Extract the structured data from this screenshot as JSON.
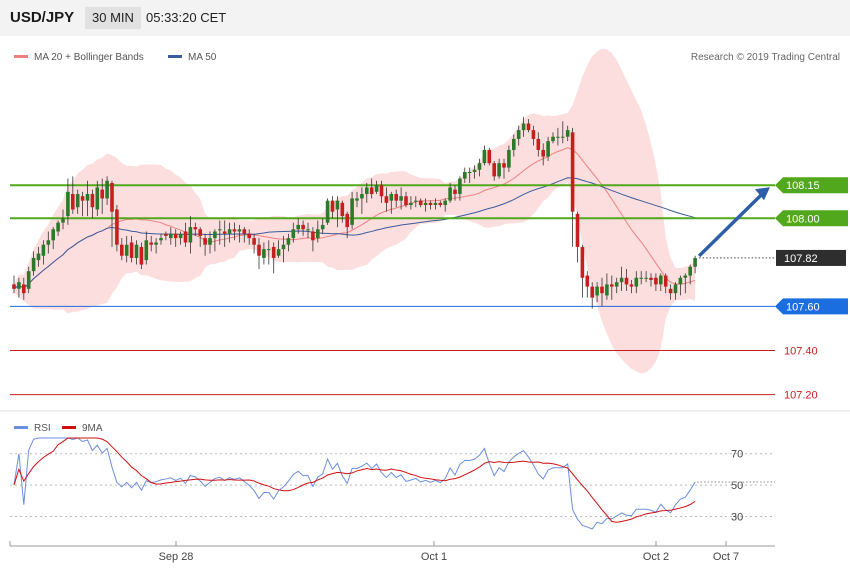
{
  "header": {
    "symbol": "USD/JPY",
    "timeframe": "30 MIN",
    "time": "05:33:20 CET"
  },
  "legend": {
    "ma20": {
      "label": "MA 20 + Bollinger Bands",
      "color": "#f08080"
    },
    "ma50": {
      "label": "MA 50",
      "color": "#3a5c9c"
    }
  },
  "credit": "Research © 2019 Trading Central",
  "rsi_legend": {
    "rsi": {
      "label": "RSI",
      "color": "#6a8ee0"
    },
    "ma9": {
      "label": "9MA",
      "color": "#d01010"
    }
  },
  "chart_data": {
    "type": "candlestick",
    "x_labels": [
      "Sep 28",
      "Oct 1",
      "Oct 2",
      "Oct 7"
    ],
    "price_ylim": [
      107.13,
      108.7
    ],
    "levels": [
      {
        "value": 108.15,
        "label": "108.15",
        "kind": "resistance",
        "color": "#52a81c"
      },
      {
        "value": 108.0,
        "label": "108.00",
        "kind": "resistance",
        "color": "#52a81c"
      },
      {
        "value": 107.82,
        "label": "107.82",
        "kind": "current",
        "color": "#222222"
      },
      {
        "value": 107.6,
        "label": "107.60",
        "kind": "support",
        "color": "#1a6ee0"
      },
      {
        "value": 107.4,
        "label": "107.40",
        "kind": "support",
        "color": "#c81e1e"
      },
      {
        "value": 107.2,
        "label": "107.20",
        "kind": "support",
        "color": "#c81e1e"
      }
    ],
    "candles": [
      [
        107.7,
        107.68,
        107.74,
        107.66
      ],
      [
        107.68,
        107.71,
        107.73,
        107.64
      ],
      [
        107.7,
        107.66,
        107.73,
        107.63
      ],
      [
        107.68,
        107.76,
        107.78,
        107.66
      ],
      [
        107.76,
        107.82,
        107.85,
        107.74
      ],
      [
        107.81,
        107.84,
        107.87,
        107.78
      ],
      [
        107.83,
        107.88,
        107.9,
        107.79
      ],
      [
        107.88,
        107.9,
        107.94,
        107.84
      ],
      [
        107.9,
        107.95,
        107.96,
        107.86
      ],
      [
        107.94,
        107.98,
        107.99,
        107.92
      ],
      [
        107.98,
        108.0,
        108.04,
        107.95
      ],
      [
        108.01,
        108.12,
        108.18,
        107.97
      ],
      [
        108.11,
        108.04,
        108.19,
        108.02
      ],
      [
        108.05,
        108.11,
        108.13,
        108.02
      ],
      [
        108.1,
        108.08,
        108.12,
        108.01
      ],
      [
        108.08,
        108.11,
        108.17,
        108.01
      ],
      [
        108.11,
        108.05,
        108.13,
        108.0
      ],
      [
        108.04,
        108.14,
        108.17,
        108.01
      ],
      [
        108.13,
        108.09,
        108.18,
        108.02
      ],
      [
        108.09,
        108.17,
        108.19,
        108.06
      ],
      [
        108.16,
        108.03,
        108.17,
        107.87
      ],
      [
        108.04,
        107.88,
        108.06,
        107.85
      ],
      [
        107.88,
        107.83,
        107.91,
        107.81
      ],
      [
        107.83,
        107.88,
        107.92,
        107.8
      ],
      [
        107.89,
        107.82,
        107.92,
        107.8
      ],
      [
        107.82,
        107.88,
        107.9,
        107.79
      ],
      [
        107.87,
        107.79,
        107.89,
        107.77
      ],
      [
        107.81,
        107.9,
        107.94,
        107.79
      ],
      [
        107.89,
        107.88,
        107.92,
        107.85
      ],
      [
        107.88,
        107.89,
        107.91,
        107.84
      ],
      [
        107.9,
        107.91,
        107.93,
        107.88
      ],
      [
        107.93,
        107.92,
        107.94,
        107.9
      ],
      [
        107.91,
        107.93,
        107.96,
        107.88
      ],
      [
        107.93,
        107.91,
        107.95,
        107.87
      ],
      [
        107.91,
        107.93,
        107.94,
        107.88
      ],
      [
        107.94,
        107.89,
        107.98,
        107.87
      ],
      [
        107.89,
        107.96,
        108.01,
        107.84
      ],
      [
        107.96,
        107.95,
        107.98,
        107.92
      ],
      [
        107.95,
        107.92,
        107.96,
        107.87
      ],
      [
        107.91,
        107.88,
        107.93,
        107.83
      ],
      [
        107.88,
        107.91,
        107.94,
        107.84
      ],
      [
        107.91,
        107.94,
        107.95,
        107.85
      ],
      [
        107.95,
        107.95,
        107.99,
        107.88
      ],
      [
        107.94,
        107.93,
        107.99,
        107.87
      ],
      [
        107.93,
        107.95,
        107.98,
        107.89
      ],
      [
        107.95,
        107.94,
        107.98,
        107.9
      ],
      [
        107.94,
        107.95,
        107.97,
        107.89
      ],
      [
        107.95,
        107.93,
        107.96,
        107.89
      ],
      [
        107.93,
        107.91,
        107.95,
        107.88
      ],
      [
        107.91,
        107.88,
        107.93,
        107.84
      ],
      [
        107.88,
        107.83,
        107.91,
        107.77
      ],
      [
        107.82,
        107.86,
        107.89,
        107.79
      ],
      [
        107.86,
        107.86,
        107.9,
        107.79
      ],
      [
        107.87,
        107.82,
        107.89,
        107.75
      ],
      [
        107.83,
        107.86,
        107.9,
        107.82
      ],
      [
        107.86,
        107.88,
        107.92,
        107.8
      ],
      [
        107.88,
        107.91,
        107.93,
        107.85
      ],
      [
        107.91,
        107.95,
        107.98,
        107.89
      ],
      [
        107.95,
        107.97,
        108.0,
        107.93
      ],
      [
        107.97,
        107.95,
        107.99,
        107.92
      ],
      [
        107.95,
        107.95,
        107.98,
        107.91
      ],
      [
        107.94,
        107.9,
        107.96,
        107.85
      ],
      [
        107.91,
        107.95,
        107.99,
        107.89
      ],
      [
        107.95,
        107.97,
        108.0,
        107.93
      ],
      [
        107.98,
        108.08,
        108.09,
        107.97
      ],
      [
        108.08,
        108.03,
        108.1,
        108.0
      ],
      [
        108.04,
        108.08,
        108.1,
        107.96
      ],
      [
        108.07,
        108.01,
        108.08,
        107.98
      ],
      [
        108.02,
        107.96,
        108.03,
        107.91
      ],
      [
        107.97,
        108.09,
        108.12,
        107.95
      ],
      [
        108.08,
        108.09,
        108.12,
        108.05
      ],
      [
        108.09,
        108.11,
        108.14,
        108.02
      ],
      [
        108.11,
        108.14,
        108.16,
        108.07
      ],
      [
        108.14,
        108.11,
        108.18,
        108.09
      ],
      [
        108.12,
        108.15,
        108.17,
        108.11
      ],
      [
        108.15,
        108.1,
        108.17,
        108.07
      ],
      [
        108.1,
        108.07,
        108.14,
        108.03
      ],
      [
        108.08,
        108.11,
        108.12,
        108.02
      ],
      [
        108.11,
        108.08,
        108.13,
        108.05
      ],
      [
        108.08,
        108.1,
        108.14,
        108.04
      ],
      [
        108.1,
        108.06,
        108.12,
        108.05
      ],
      [
        108.06,
        108.07,
        108.1,
        108.04
      ],
      [
        108.08,
        108.08,
        108.1,
        108.05
      ],
      [
        108.08,
        108.06,
        108.09,
        108.05
      ],
      [
        108.06,
        108.07,
        108.09,
        108.03
      ],
      [
        108.07,
        108.06,
        108.08,
        108.04
      ],
      [
        108.06,
        108.07,
        108.09,
        108.04
      ],
      [
        108.07,
        108.06,
        108.08,
        108.05
      ],
      [
        108.06,
        108.08,
        108.09,
        108.03
      ],
      [
        108.08,
        108.14,
        108.16,
        108.07
      ],
      [
        108.13,
        108.11,
        108.15,
        108.08
      ],
      [
        108.11,
        108.18,
        108.19,
        108.08
      ],
      [
        108.18,
        108.21,
        108.23,
        108.16
      ],
      [
        108.21,
        108.21,
        108.23,
        108.16
      ],
      [
        108.21,
        108.22,
        108.24,
        108.18
      ],
      [
        108.22,
        108.25,
        108.27,
        108.19
      ],
      [
        108.25,
        108.31,
        108.33,
        108.24
      ],
      [
        108.31,
        108.25,
        108.32,
        108.24
      ],
      [
        108.25,
        108.19,
        108.26,
        108.17
      ],
      [
        108.19,
        108.25,
        108.27,
        108.18
      ],
      [
        108.25,
        108.23,
        108.27,
        108.18
      ],
      [
        108.23,
        108.31,
        108.33,
        108.21
      ],
      [
        108.31,
        108.36,
        108.38,
        108.28
      ],
      [
        108.36,
        108.4,
        108.42,
        108.33
      ],
      [
        108.4,
        108.43,
        108.46,
        108.37
      ],
      [
        108.43,
        108.4,
        108.45,
        108.39
      ],
      [
        108.4,
        108.36,
        108.42,
        108.33
      ],
      [
        108.36,
        108.31,
        108.39,
        108.28
      ],
      [
        108.31,
        108.28,
        108.34,
        108.24
      ],
      [
        108.28,
        108.35,
        108.37,
        108.26
      ],
      [
        108.35,
        108.37,
        108.39,
        108.34
      ],
      [
        108.37,
        108.37,
        108.41,
        108.33
      ],
      [
        108.37,
        108.37,
        108.44,
        108.34
      ],
      [
        108.37,
        108.4,
        108.42,
        108.35
      ],
      [
        108.39,
        108.03,
        108.41,
        107.87
      ],
      [
        108.02,
        107.87,
        108.03,
        107.8
      ],
      [
        107.87,
        107.73,
        107.88,
        107.64
      ],
      [
        107.74,
        107.69,
        107.76,
        107.64
      ],
      [
        107.69,
        107.64,
        107.71,
        107.59
      ],
      [
        107.65,
        107.69,
        107.71,
        107.62
      ],
      [
        107.69,
        107.66,
        107.73,
        107.6
      ],
      [
        107.65,
        107.7,
        107.75,
        107.63
      ],
      [
        107.7,
        107.69,
        107.74,
        107.63
      ],
      [
        107.69,
        107.71,
        107.73,
        107.66
      ],
      [
        107.71,
        107.73,
        107.78,
        107.67
      ],
      [
        107.73,
        107.7,
        107.77,
        107.67
      ],
      [
        107.7,
        107.69,
        107.72,
        107.66
      ],
      [
        107.69,
        107.73,
        107.76,
        107.66
      ],
      [
        107.73,
        107.73,
        107.76,
        107.7
      ],
      [
        107.73,
        107.73,
        107.76,
        107.71
      ],
      [
        107.73,
        107.72,
        107.75,
        107.69
      ],
      [
        107.73,
        107.7,
        107.75,
        107.67
      ],
      [
        107.7,
        107.74,
        107.75,
        107.67
      ],
      [
        107.74,
        107.69,
        107.75,
        107.66
      ],
      [
        107.68,
        107.66,
        107.7,
        107.63
      ],
      [
        107.66,
        107.7,
        107.71,
        107.63
      ],
      [
        107.7,
        107.73,
        107.74,
        107.65
      ],
      [
        107.73,
        107.74,
        107.75,
        107.66
      ],
      [
        107.74,
        107.78,
        107.79,
        107.7
      ],
      [
        107.78,
        107.82,
        107.83,
        107.75
      ]
    ],
    "forecast_arrow": {
      "from": 107.82,
      "to": 108.15
    },
    "rsi": {
      "ylim": [
        15,
        80
      ],
      "ticks": [
        30,
        50,
        70
      ],
      "current": 52
    }
  }
}
